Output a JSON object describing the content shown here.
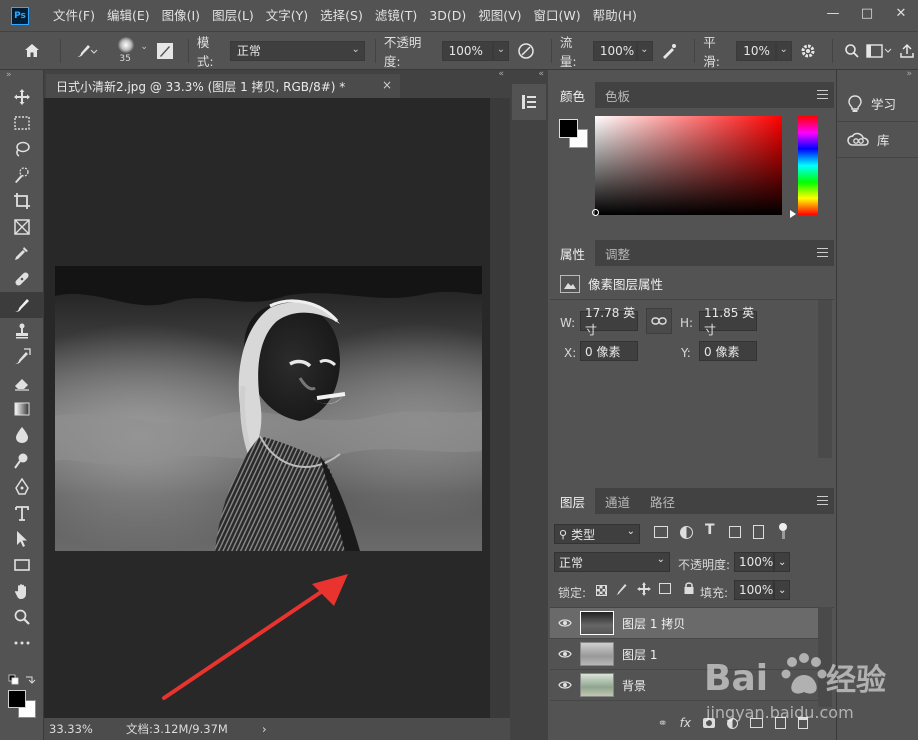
{
  "app": {
    "logo_text": "Ps"
  },
  "menu": [
    "文件(F)",
    "编辑(E)",
    "图像(I)",
    "图层(L)",
    "文字(Y)",
    "选择(S)",
    "滤镜(T)",
    "3D(D)",
    "视图(V)",
    "窗口(W)",
    "帮助(H)"
  ],
  "window_controls": {
    "minimize": "—",
    "maximize": "□",
    "close": "✕"
  },
  "options": {
    "brush_size": "35",
    "mode_label": "模式:",
    "mode_value": "正常",
    "opacity_label": "不透明度:",
    "opacity_value": "100%",
    "flow_label": "流量:",
    "flow_value": "100%",
    "smooth_label": "平滑:",
    "smooth_value": "10%"
  },
  "document": {
    "tab_title": "日式小清新2.jpg @ 33.3% (图层 1 拷贝, RGB/8#) *",
    "close": "×",
    "zoom": "33.33%",
    "doc_info": "文档:3.12M/9.37M",
    "status_arrow": "›"
  },
  "color_panel": {
    "tabs": [
      "颜色",
      "色板"
    ],
    "active_tab": 0
  },
  "properties_panel": {
    "tabs": [
      "属性",
      "调整"
    ],
    "section_title": "像素图层属性",
    "w_label": "W:",
    "w_value": "17.78 英寸",
    "h_label": "H:",
    "h_value": "11.85 英寸",
    "x_label": "X:",
    "x_value": "0 像素",
    "y_label": "Y:",
    "y_value": "0 像素"
  },
  "layers_panel": {
    "tabs": [
      "图层",
      "通道",
      "路径"
    ],
    "filter_label": "类型",
    "blend_mode": "正常",
    "opacity_label": "不透明度:",
    "opacity_value": "100%",
    "lock_label": "锁定:",
    "fill_label": "填充:",
    "fill_value": "100%",
    "layers": [
      {
        "name": "图层 1 拷贝",
        "selected": true
      },
      {
        "name": "图层 1",
        "selected": false
      },
      {
        "name": "背景",
        "selected": false
      }
    ]
  },
  "learn_panel": {
    "items": [
      "学习",
      "库"
    ]
  },
  "colors": {
    "accent_red": "#e8332e",
    "ps_blue": "#31a8ff",
    "panel_bg": "#535353",
    "canvas_bg": "#282828"
  }
}
